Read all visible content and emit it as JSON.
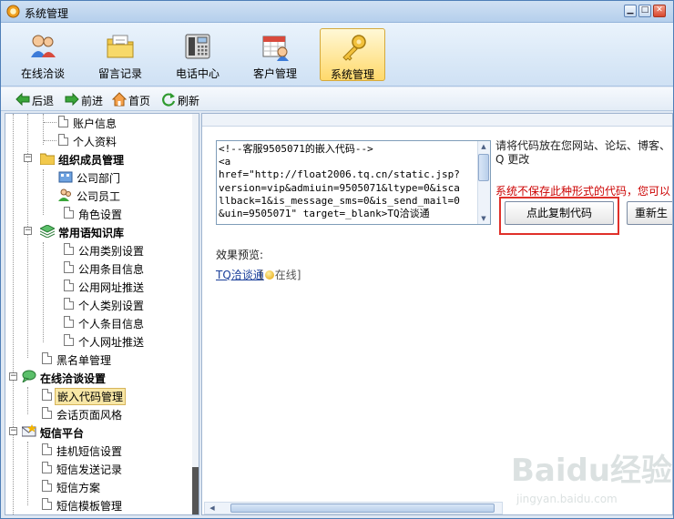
{
  "window": {
    "title": "系统管理",
    "min_glyph": "▁",
    "max_glyph": "□",
    "close_glyph": "✕"
  },
  "toolbar": {
    "items": [
      {
        "label": "在线洽谈",
        "icon": "users-chat-icon",
        "active": false
      },
      {
        "label": "留言记录",
        "icon": "folder-notes-icon",
        "active": false
      },
      {
        "label": "电话中心",
        "icon": "phone-icon",
        "active": false
      },
      {
        "label": "客户管理",
        "icon": "customer-calendar-icon",
        "active": false
      },
      {
        "label": "系统管理",
        "icon": "key-icon",
        "active": true
      }
    ]
  },
  "navbar": {
    "back": "后退",
    "forward": "前进",
    "home": "首页",
    "refresh": "刷新"
  },
  "tree": {
    "items": [
      {
        "label": "账户信息"
      },
      {
        "label": "个人资料"
      },
      {
        "label": "组织成员管理"
      },
      {
        "label": "公司部门"
      },
      {
        "label": "公司员工"
      },
      {
        "label": "角色设置"
      },
      {
        "label": "常用语知识库"
      },
      {
        "label": "公用类别设置"
      },
      {
        "label": "公用条目信息"
      },
      {
        "label": "公用网址推送"
      },
      {
        "label": "个人类别设置"
      },
      {
        "label": "个人条目信息"
      },
      {
        "label": "个人网址推送"
      },
      {
        "label": "黑名单管理"
      },
      {
        "label": "在线洽谈设置"
      },
      {
        "label": "嵌入代码管理"
      },
      {
        "label": "会话页面风格"
      },
      {
        "label": "短信平台"
      },
      {
        "label": "挂机短信设置"
      },
      {
        "label": "短信发送记录"
      },
      {
        "label": "短信方案"
      },
      {
        "label": "短信模板管理"
      }
    ]
  },
  "content": {
    "code": "<!--客服9505071的嵌入代码-->\n<a\nhref=\"http://float2006.tq.cn/static.jsp?\nversion=vip&admiuin=9505071&ltype=0&isca\nllback=1&is_message_sms=0&is_send_mail=0\n&uin=9505071\" target=_blank>TQ洽谈通",
    "hint": "请将代码放在您网站、论坛、博客、Q 更改",
    "warning": "系统不保存此种形式的代码，您可以",
    "copy_button": "点此复制代码",
    "regen_button": "重新生",
    "preview_label": "效果预览:",
    "preview_link": "TQ洽谈通",
    "preview_status_open": "[",
    "preview_status": "在线",
    "preview_status_close": "]"
  },
  "watermark": {
    "text": "Baidu经验",
    "sub": "jingyan.baidu.com"
  },
  "colors": {
    "accent": "#ffd96b",
    "warning": "#cc0000",
    "highlight_frame": "#e0302a"
  }
}
